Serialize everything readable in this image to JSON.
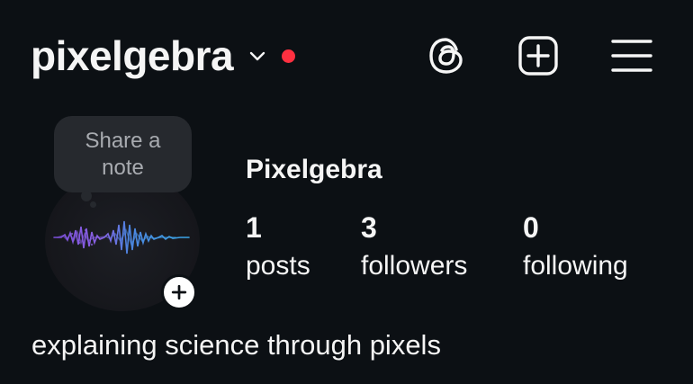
{
  "header": {
    "username": "pixelgebra",
    "has_notification": true,
    "notification_color": "#ff3040",
    "icons": [
      "threads-icon",
      "create-icon",
      "menu-icon"
    ]
  },
  "note": {
    "line1": "Share a",
    "line2": "note"
  },
  "profile": {
    "display_name": "Pixelgebra",
    "avatar_icon": "waveform-icon",
    "stats": {
      "posts": {
        "count": "1",
        "label": "posts"
      },
      "followers": {
        "count": "3",
        "label": "followers"
      },
      "following": {
        "count": "0",
        "label": "following"
      }
    },
    "bio": "explaining science through pixels"
  },
  "colors": {
    "background": "#0c1014",
    "text": "#f5f5f5",
    "bubble": "#26292e",
    "bubble_text": "#a8abb0"
  }
}
